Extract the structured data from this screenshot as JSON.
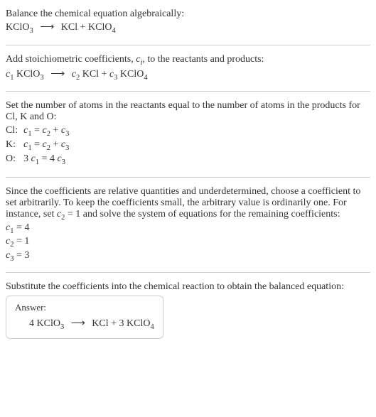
{
  "step1": {
    "text": "Balance the chemical equation algebraically:",
    "equation_left": "KClO",
    "equation_left_sub": "3",
    "arrow": "⟶",
    "equation_right_1": "KCl + KClO",
    "equation_right_1_sub": "4"
  },
  "step2": {
    "text_a": "Add stoichiometric coefficients, ",
    "text_ci": "c",
    "text_ci_sub": "i",
    "text_b": ", to the reactants and products:",
    "eq_c1": "c",
    "eq_c1_sub": "1",
    "eq_sp1": " KClO",
    "eq_sp1_sub": "3",
    "arrow": "⟶",
    "eq_c2": "c",
    "eq_c2_sub": "2",
    "eq_sp2": " KCl + ",
    "eq_c3": "c",
    "eq_c3_sub": "3",
    "eq_sp3": " KClO",
    "eq_sp3_sub": "4"
  },
  "step3": {
    "text": "Set the number of atoms in the reactants equal to the number of atoms in the products for Cl, K and O:",
    "rows": [
      {
        "label": "Cl:",
        "c1": "c",
        "c1s": "1",
        "eq": " = ",
        "c2": "c",
        "c2s": "2",
        "plus": " + ",
        "c3": "c",
        "c3s": "3",
        "pre": ""
      },
      {
        "label": "K:",
        "c1": "c",
        "c1s": "1",
        "eq": " = ",
        "c2": "c",
        "c2s": "2",
        "plus": " + ",
        "c3": "c",
        "c3s": "3",
        "pre": ""
      },
      {
        "label": "O:",
        "c1": "c",
        "c1s": "1",
        "eq": " = 4 ",
        "c2": "",
        "c2s": "",
        "plus": "",
        "c3": "c",
        "c3s": "3",
        "pre": "3 "
      }
    ]
  },
  "step4": {
    "text_a": "Since the coefficients are relative quantities and underdetermined, choose a coefficient to set arbitrarily. To keep the coefficients small, the arbitrary value is ordinarily one. For instance, set ",
    "cvar": "c",
    "cvar_sub": "2",
    "text_b": " = 1 and solve the system of equations for the remaining coefficients:",
    "lines": [
      {
        "c": "c",
        "cs": "1",
        "rhs": " = 4"
      },
      {
        "c": "c",
        "cs": "2",
        "rhs": " = 1"
      },
      {
        "c": "c",
        "cs": "3",
        "rhs": " = 3"
      }
    ]
  },
  "step5": {
    "text": "Substitute the coefficients into the chemical reaction to obtain the balanced equation:"
  },
  "answer": {
    "label": "Answer:",
    "coef1": "4 KClO",
    "sub1": "3",
    "arrow": "⟶",
    "mid": "KCl + 3 KClO",
    "sub2": "4"
  },
  "chart_data": {
    "type": "table",
    "title": "Balanced chemical equation coefficients",
    "reaction_unbalanced": "KClO3 -> KCl + KClO4",
    "atom_balance": [
      {
        "element": "Cl",
        "equation": "c1 = c2 + c3"
      },
      {
        "element": "K",
        "equation": "c1 = c2 + c3"
      },
      {
        "element": "O",
        "equation": "3 c1 = 4 c3"
      }
    ],
    "solution": {
      "c1": 4,
      "c2": 1,
      "c3": 3
    },
    "reaction_balanced": "4 KClO3 -> KCl + 3 KClO4"
  }
}
